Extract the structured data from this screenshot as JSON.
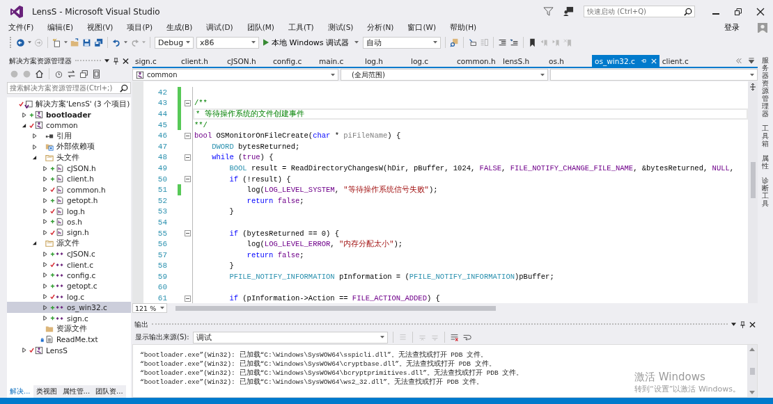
{
  "window": {
    "title": "LensS - Microsoft Visual Studio",
    "quick_launch": {
      "placeholder": "快速启动 (Ctrl+Q)"
    }
  },
  "menu": [
    "文件(F)",
    "编辑(E)",
    "视图(V)",
    "项目(P)",
    "生成(B)",
    "调试(D)",
    "团队(M)",
    "工具(T)",
    "测试(S)",
    "分析(N)",
    "窗口(W)",
    "帮助(H)"
  ],
  "sign_in": "登录",
  "toolbar": {
    "configuration": "Debug",
    "platform": "x86",
    "run": "本地 Windows 调试器",
    "run_mode": "自动"
  },
  "solution_explorer": {
    "title": "解决方案资源管理器",
    "search": {
      "placeholder": "搜索解决方案资源管理器(Ctrl+;)"
    },
    "tree": [
      {
        "label": "解决方案'LensS' (3 个项目)",
        "kind": "solution",
        "pending_add": false,
        "checked_out": true,
        "locked": false,
        "selected": false,
        "children": [
          {
            "label": "bootloader",
            "kind": "project",
            "pending_add": true,
            "checked_out": false,
            "locked": false,
            "startup": true,
            "expanded": false,
            "selected": false
          },
          {
            "label": "common",
            "kind": "project",
            "pending_add": false,
            "checked_out": true,
            "locked": false,
            "startup": false,
            "expanded": true,
            "selected": false,
            "children": [
              {
                "label": "引用",
                "kind": "references",
                "pending_add": false,
                "checked_out": false,
                "locked": false,
                "expanded": false,
                "selected": false
              },
              {
                "label": "外部依赖项",
                "kind": "external",
                "pending_add": false,
                "checked_out": false,
                "locked": false,
                "expanded": false,
                "selected": false
              },
              {
                "label": "头文件",
                "kind": "folder",
                "pending_add": false,
                "checked_out": false,
                "locked": false,
                "expanded": true,
                "selected": false,
                "children": [
                  {
                    "label": "cJSON.h",
                    "kind": "header",
                    "pending_add": true,
                    "checked_out": false,
                    "locked": false,
                    "expanded": false,
                    "selected": false
                  },
                  {
                    "label": "client.h",
                    "kind": "header",
                    "pending_add": true,
                    "checked_out": false,
                    "locked": false,
                    "expanded": false,
                    "selected": false
                  },
                  {
                    "label": "common.h",
                    "kind": "header",
                    "pending_add": false,
                    "checked_out": true,
                    "locked": false,
                    "expanded": false,
                    "selected": false
                  },
                  {
                    "label": "getopt.h",
                    "kind": "header",
                    "pending_add": true,
                    "checked_out": false,
                    "locked": false,
                    "expanded": false,
                    "selected": false
                  },
                  {
                    "label": "log.h",
                    "kind": "header",
                    "pending_add": false,
                    "checked_out": true,
                    "locked": false,
                    "expanded": false,
                    "selected": false
                  },
                  {
                    "label": "os.h",
                    "kind": "header",
                    "pending_add": true,
                    "checked_out": false,
                    "locked": false,
                    "expanded": false,
                    "selected": false
                  },
                  {
                    "label": "sign.h",
                    "kind": "header",
                    "pending_add": false,
                    "checked_out": true,
                    "locked": false,
                    "expanded": false,
                    "selected": false
                  }
                ]
              },
              {
                "label": "源文件",
                "kind": "folder",
                "pending_add": false,
                "checked_out": false,
                "locked": false,
                "expanded": true,
                "selected": false,
                "children": [
                  {
                    "label": "cJSON.c",
                    "kind": "source",
                    "pending_add": true,
                    "checked_out": false,
                    "locked": false,
                    "expanded": false,
                    "selected": false
                  },
                  {
                    "label": "client.c",
                    "kind": "source",
                    "pending_add": false,
                    "checked_out": true,
                    "locked": false,
                    "expanded": false,
                    "selected": false
                  },
                  {
                    "label": "config.c",
                    "kind": "source",
                    "pending_add": true,
                    "checked_out": false,
                    "locked": false,
                    "expanded": false,
                    "selected": false
                  },
                  {
                    "label": "getopt.c",
                    "kind": "source",
                    "pending_add": true,
                    "checked_out": false,
                    "locked": false,
                    "expanded": false,
                    "selected": false
                  },
                  {
                    "label": "log.c",
                    "kind": "source",
                    "pending_add": false,
                    "checked_out": true,
                    "locked": false,
                    "expanded": false,
                    "selected": false
                  },
                  {
                    "label": "os_win32.c",
                    "kind": "source",
                    "pending_add": true,
                    "checked_out": false,
                    "locked": false,
                    "expanded": false,
                    "selected": true
                  },
                  {
                    "label": "sign.c",
                    "kind": "source",
                    "pending_add": true,
                    "checked_out": false,
                    "locked": false,
                    "expanded": false,
                    "selected": false
                  }
                ]
              },
              {
                "label": "资源文件",
                "kind": "folder-closed",
                "pending_add": false,
                "checked_out": false,
                "locked": false,
                "selected": false
              },
              {
                "label": "ReadMe.txt",
                "kind": "text",
                "pending_add": false,
                "checked_out": false,
                "locked": true,
                "selected": false
              }
            ]
          },
          {
            "label": "LensS",
            "kind": "project",
            "pending_add": false,
            "checked_out": true,
            "locked": false,
            "startup": false,
            "expanded": false,
            "selected": false
          }
        ]
      }
    ],
    "tabs": [
      {
        "label": "解决...",
        "selected": true
      },
      {
        "label": "类视图",
        "selected": false
      },
      {
        "label": "属性管...",
        "selected": false
      },
      {
        "label": "团队资...",
        "selected": false
      }
    ]
  },
  "editor": {
    "tabs": [
      {
        "label": "sign.c",
        "selected": false
      },
      {
        "label": "client.h",
        "selected": false
      },
      {
        "label": "cJSON.h",
        "selected": false
      },
      {
        "label": "config.c",
        "selected": false
      },
      {
        "label": "main.c",
        "selected": false
      },
      {
        "label": "log.h",
        "selected": false
      },
      {
        "label": "log.c",
        "selected": false
      },
      {
        "label": "common.h",
        "selected": false
      },
      {
        "label": "lensS.h",
        "selected": false
      },
      {
        "label": "os.h",
        "selected": false
      },
      {
        "label": "os_win32.c",
        "selected": true
      },
      {
        "label": "client.c",
        "selected": false
      }
    ],
    "project": "common",
    "scope": "(全局范围)",
    "zoom": "121 %",
    "lines": [
      {
        "number": "42",
        "changed": true,
        "fold": false,
        "current": false
      },
      {
        "number": "43",
        "changed": true,
        "fold": true,
        "current": false,
        "tokens": [
          {
            "kind": "comment",
            "text": "/**"
          }
        ]
      },
      {
        "number": "44",
        "changed": true,
        "fold": false,
        "current": true,
        "tokens": [
          {
            "kind": "comment",
            "text": "* 等待操作系统的文件创建事件"
          }
        ]
      },
      {
        "number": "45",
        "changed": true,
        "fold": false,
        "current": false,
        "tokens": [
          {
            "kind": "comment",
            "text": "**/"
          }
        ]
      },
      {
        "number": "46",
        "changed": false,
        "fold": true,
        "current": false,
        "tokens": [
          {
            "kind": "macro",
            "text": "bool"
          },
          {
            "kind": "plain",
            "text": " OSMonitorOnFileCreate("
          },
          {
            "kind": "keyword",
            "text": "char"
          },
          {
            "kind": "plain",
            "text": " * "
          },
          {
            "kind": "param",
            "text": "piFileName"
          },
          {
            "kind": "plain",
            "text": ") {"
          }
        ]
      },
      {
        "number": "47",
        "changed": false,
        "fold": false,
        "current": false,
        "tokens": [
          {
            "kind": "type",
            "text": "    DWORD"
          },
          {
            "kind": "plain",
            "text": " bytesReturned;"
          }
        ]
      },
      {
        "number": "48",
        "changed": false,
        "fold": true,
        "current": false,
        "tokens": [
          {
            "kind": "keyword",
            "text": "    while"
          },
          {
            "kind": "plain",
            "text": " ("
          },
          {
            "kind": "macro",
            "text": "true"
          },
          {
            "kind": "plain",
            "text": ") {"
          }
        ]
      },
      {
        "number": "49",
        "changed": false,
        "fold": false,
        "current": false,
        "tokens": [
          {
            "kind": "type",
            "text": "        BOOL"
          },
          {
            "kind": "plain",
            "text": " result = ReadDirectoryChangesW(hDir, pBuffer, 1024, "
          },
          {
            "kind": "macro",
            "text": "FALSE"
          },
          {
            "kind": "plain",
            "text": ", "
          },
          {
            "kind": "macro",
            "text": "FILE_NOTIFY_CHANGE_FILE_NAME"
          },
          {
            "kind": "plain",
            "text": ", &bytesReturned, "
          },
          {
            "kind": "macro",
            "text": "NULL"
          },
          {
            "kind": "plain",
            "text": ","
          }
        ]
      },
      {
        "number": "50",
        "changed": false,
        "fold": true,
        "current": false,
        "tokens": [
          {
            "kind": "keyword",
            "text": "        if"
          },
          {
            "kind": "plain",
            "text": " (!result) {"
          }
        ]
      },
      {
        "number": "51",
        "changed": true,
        "fold": false,
        "current": false,
        "tokens": [
          {
            "kind": "plain",
            "text": "            log("
          },
          {
            "kind": "macro",
            "text": "LOG_LEVEL_SYSTEM"
          },
          {
            "kind": "plain",
            "text": ", "
          },
          {
            "kind": "string",
            "text": "\"等待操作系统信号失败\""
          },
          {
            "kind": "plain",
            "text": ");"
          }
        ]
      },
      {
        "number": "52",
        "changed": false,
        "fold": false,
        "current": false,
        "tokens": [
          {
            "kind": "keyword",
            "text": "            return"
          },
          {
            "kind": "macro",
            "text": " false"
          },
          {
            "kind": "plain",
            "text": ";"
          }
        ]
      },
      {
        "number": "53",
        "changed": false,
        "fold": false,
        "current": false,
        "tokens": [
          {
            "kind": "plain",
            "text": "        }"
          }
        ]
      },
      {
        "number": "54",
        "changed": false,
        "fold": false,
        "current": false
      },
      {
        "number": "55",
        "changed": false,
        "fold": true,
        "current": false,
        "tokens": [
          {
            "kind": "keyword",
            "text": "        if"
          },
          {
            "kind": "plain",
            "text": " (bytesReturned == 0) {"
          }
        ]
      },
      {
        "number": "56",
        "changed": false,
        "fold": false,
        "current": false,
        "tokens": [
          {
            "kind": "plain",
            "text": "            log("
          },
          {
            "kind": "macro",
            "text": "LOG_LEVEL_ERROR"
          },
          {
            "kind": "plain",
            "text": ", "
          },
          {
            "kind": "string",
            "text": "\"内存分配太小\""
          },
          {
            "kind": "plain",
            "text": ");"
          }
        ]
      },
      {
        "number": "57",
        "changed": false,
        "fold": false,
        "current": false,
        "tokens": [
          {
            "kind": "keyword",
            "text": "            return"
          },
          {
            "kind": "macro",
            "text": " false"
          },
          {
            "kind": "plain",
            "text": ";"
          }
        ]
      },
      {
        "number": "58",
        "changed": false,
        "fold": false,
        "current": false,
        "tokens": [
          {
            "kind": "plain",
            "text": "        }"
          }
        ]
      },
      {
        "number": "59",
        "changed": false,
        "fold": false,
        "current": false,
        "tokens": [
          {
            "kind": "type",
            "text": "        PFILE_NOTIFY_INFORMATION"
          },
          {
            "kind": "plain",
            "text": " pInformation = ("
          },
          {
            "kind": "type",
            "text": "PFILE_NOTIFY_INFORMATION"
          },
          {
            "kind": "plain",
            "text": ")pBuffer;"
          }
        ]
      },
      {
        "number": "60",
        "changed": false,
        "fold": false,
        "current": false
      },
      {
        "number": "61",
        "changed": false,
        "fold": true,
        "current": false,
        "tokens": [
          {
            "kind": "keyword",
            "text": "        if"
          },
          {
            "kind": "plain",
            "text": " (pInformation->Action == "
          },
          {
            "kind": "macro",
            "text": "FILE_ACTION_ADDED"
          },
          {
            "kind": "plain",
            "text": ") {"
          }
        ]
      }
    ]
  },
  "output": {
    "title": "输出",
    "source_label": "显示输出来源(S):",
    "source": "调试",
    "lines": [
      "“bootloader.exe”(Win32): 已加载“C:\\Windows\\SysWOW64\\sspicli.dll”。无法查找或打开 PDB 文件。",
      "“bootloader.exe”(Win32): 已加载“C:\\Windows\\SysWOW64\\cryptbase.dll”。无法查找或打开 PDB 文件。",
      "“bootloader.exe”(Win32): 已加载“C:\\Windows\\SysWOW64\\bcryptprimitives.dll”。无法查找或打开 PDB 文件。",
      "“bootloader.exe”(Win32): 已加载“C:\\Windows\\SysWOW64\\ws2_32.dll”。无法查找或打开 PDB 文件。"
    ]
  },
  "side_tabs": [
    "服务器资源管理器",
    "工具箱",
    "属性",
    "诊断工具"
  ],
  "activation": {
    "title": "激活 Windows",
    "text": "转到“设置”以激活 Windows。"
  }
}
